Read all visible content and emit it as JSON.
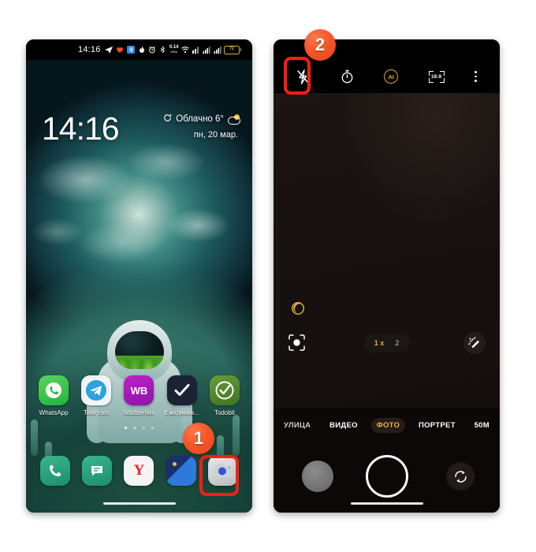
{
  "page": {
    "background": "#ffffff",
    "accent_red": "#fd1d12",
    "badge_orange": "#f5562a",
    "camera_yellow": "#e8b33c"
  },
  "left_phone": {
    "name": "android-home-screen",
    "statusbar": {
      "time": "14:16",
      "left_icons": [
        "telegram-icon",
        "health-icon",
        "bluetooth-app-icon",
        "flame-icon"
      ],
      "right_icons": [
        "alarm-icon",
        "bluetooth-icon",
        "network-speed-icon",
        "wifi-icon",
        "vpn-icon",
        "signal-sim1-icon",
        "signal-sim2-icon"
      ],
      "net_speed_value": "0.14",
      "net_speed_unit": "KB/s",
      "battery_percent": "72"
    },
    "lockinfo": {
      "clock": "14:16",
      "weather_text": "Облачно 6°",
      "weather_icon": "partly-cloudy-icon",
      "refresh_icon": "refresh-icon",
      "date": "пн, 20 мар."
    },
    "apps": [
      {
        "label": "WhatsApp",
        "icon": "whatsapp-icon"
      },
      {
        "label": "Telegram",
        "icon": "telegram-icon"
      },
      {
        "label": "Wildberries",
        "icon": "wildberries-icon",
        "glyph": "WB"
      },
      {
        "label": "Ежедневн...",
        "icon": "checkmark-icon"
      },
      {
        "label": "Todobit",
        "icon": "todobit-icon"
      }
    ],
    "page_dots": {
      "count": 4,
      "active_index": 0
    },
    "dock": [
      {
        "name": "phone-icon",
        "label": "Телефон"
      },
      {
        "name": "messages-icon",
        "label": "Сообщения"
      },
      {
        "name": "yandex-icon",
        "label": "Яндекс",
        "glyph": "Y"
      },
      {
        "name": "gallery-icon",
        "label": "Галерея"
      },
      {
        "name": "camera-icon",
        "label": "Камера"
      }
    ],
    "home_indicator": "home-indicator"
  },
  "right_phone": {
    "name": "camera-app-screen",
    "topbar": [
      {
        "name": "flash-off-icon",
        "label": "Вспышка выкл."
      },
      {
        "name": "timer-icon",
        "label": "Таймер"
      },
      {
        "name": "ai-icon",
        "label": "AI"
      },
      {
        "name": "aspect-ratio-icon",
        "label": "16:9"
      },
      {
        "name": "more-options-icon",
        "label": "Ещё"
      }
    ],
    "aspect_ratio_label": "16:9",
    "ai_label": "AI",
    "controls": {
      "night_mode_icon": "night-mode-icon",
      "lens_icon": "focus-lens-icon",
      "beauty_icon": "magic-wand-icon",
      "zoom_options": [
        {
          "label": "1 x",
          "active": true
        },
        {
          "label": "2",
          "active": false
        }
      ]
    },
    "modes": [
      {
        "label": "УЛИЦА",
        "active": false
      },
      {
        "label": "ВИДЕО",
        "active": false
      },
      {
        "label": "ФОТО",
        "active": true
      },
      {
        "label": "ПОРТРЕТ",
        "active": false
      },
      {
        "label": "50M",
        "active": false
      }
    ],
    "shutter": {
      "gallery_thumb": "gallery-thumbnail",
      "shutter_button": "shutter-button",
      "flip_camera_icon": "flip-camera-icon"
    },
    "home_indicator": "home-indicator"
  },
  "annotations": {
    "step1": {
      "number": "1",
      "target": "camera-dock-icon"
    },
    "step2": {
      "number": "2",
      "target": "flash-toggle"
    }
  }
}
